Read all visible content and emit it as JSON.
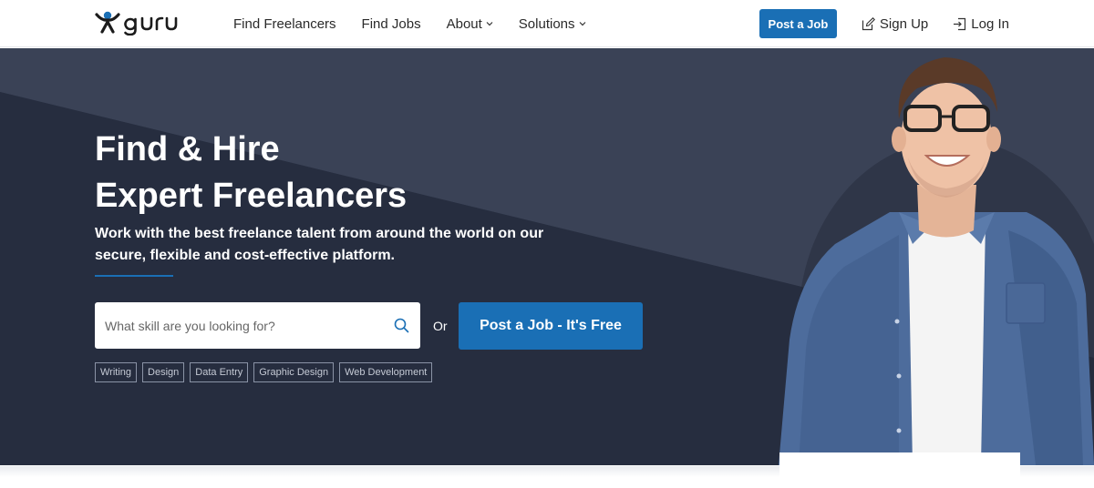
{
  "brand": {
    "name": "guru"
  },
  "nav": {
    "items": [
      {
        "label": "Find Freelancers"
      },
      {
        "label": "Find Jobs"
      },
      {
        "label": "About"
      },
      {
        "label": "Solutions"
      }
    ]
  },
  "header_actions": {
    "post_job": "Post a Job",
    "sign_up": "Sign Up",
    "log_in": "Log In"
  },
  "hero": {
    "title_line1": "Find & Hire",
    "title_line2": "Expert Freelancers",
    "subtitle": "Work with the best freelance talent from around the world on our secure, flexible and cost-effective platform.",
    "search_placeholder": "What skill are you looking for?",
    "or_text": "Or",
    "cta": "Post a Job - It's Free",
    "tags": [
      "Writing",
      "Design",
      "Data Entry",
      "Graphic Design",
      "Web Development"
    ]
  },
  "colors": {
    "accent": "#1a6fb5",
    "hero_bg": "#2d3548"
  }
}
